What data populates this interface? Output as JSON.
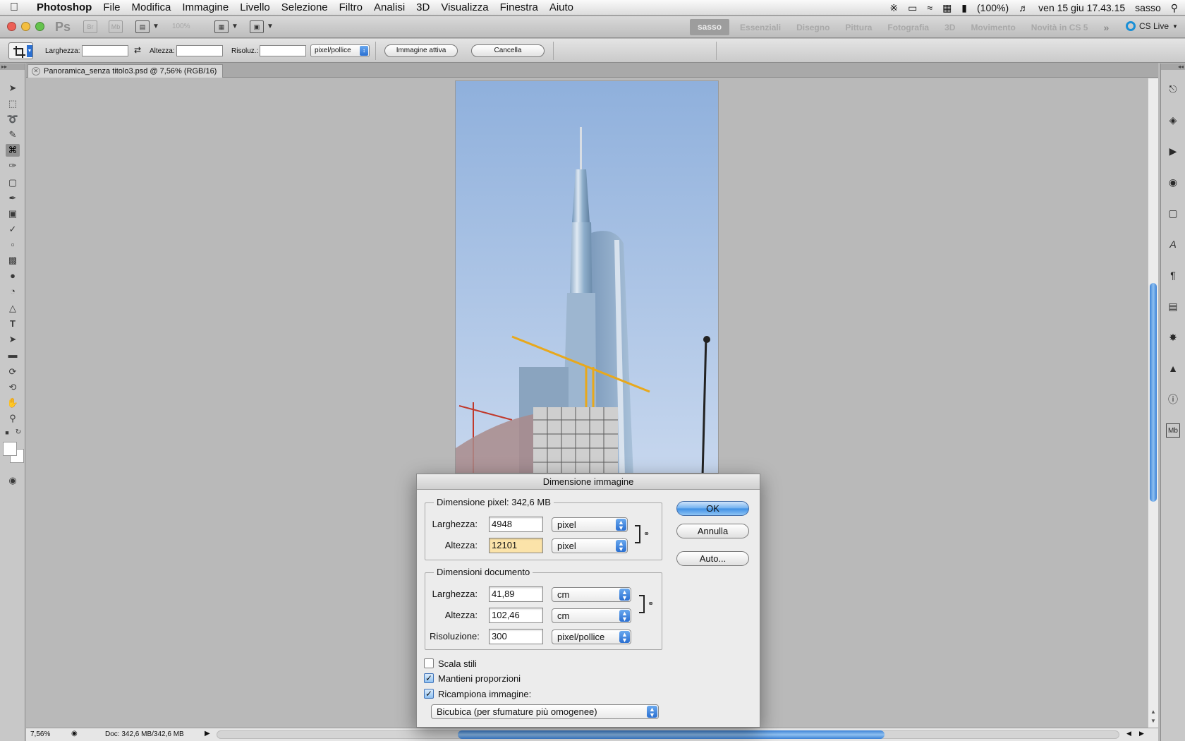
{
  "menubar": {
    "app_name": "Photoshop",
    "items": [
      "File",
      "Modifica",
      "Immagine",
      "Livello",
      "Selezione",
      "Filtro",
      "Analisi",
      "3D",
      "Visualizza",
      "Finestra",
      "Aiuto"
    ],
    "battery": "(100%)",
    "datetime": "ven 15 giu  17.43.15",
    "user": "sasso"
  },
  "appbar": {
    "ps_logo": "Ps",
    "br_label": "Br",
    "mb_label": "Mb",
    "zoom": "100%",
    "workspaces": [
      "sasso",
      "Essenziali",
      "Disegno",
      "Pittura",
      "Fotografia",
      "3D",
      "Movimento",
      "Novità in CS 5"
    ],
    "cs_live": "CS Live"
  },
  "options": {
    "width_label": "Larghezza:",
    "height_label": "Altezza:",
    "res_label": "Risoluz.:",
    "res_unit": "pixel/pollice",
    "front_image_button": "Immagine attiva",
    "clear_button": "Cancella"
  },
  "document": {
    "tab_title": "Panoramica_senza titolo3.psd @ 7,56% (RGB/16)",
    "zoom": "7,56%",
    "doc_info": "Doc: 342,6 MB/342,6 MB"
  },
  "dialog": {
    "title": "Dimensione immagine",
    "pixel_dims_label": "Dimensione pixel:",
    "pixel_dims_size": "342,6 MB",
    "px_width_label": "Larghezza:",
    "px_width_value": "4948",
    "px_width_unit": "pixel",
    "px_height_label": "Altezza:",
    "px_height_value": "12101",
    "px_height_unit": "pixel",
    "doc_dims_label": "Dimensioni documento",
    "doc_width_label": "Larghezza:",
    "doc_width_value": "41,89",
    "doc_width_unit": "cm",
    "doc_height_label": "Altezza:",
    "doc_height_value": "102,46",
    "doc_height_unit": "cm",
    "resolution_label": "Risoluzione:",
    "resolution_value": "300",
    "resolution_unit": "pixel/pollice",
    "scale_styles": "Scala stili",
    "scale_styles_checked": false,
    "constrain": "Mantieni proporzioni",
    "constrain_checked": true,
    "resample": "Ricampiona immagine:",
    "resample_checked": true,
    "resample_method": "Bicubica (per sfumature più omogenee)",
    "ok_button": "OK",
    "cancel_button": "Annulla",
    "auto_button": "Auto..."
  },
  "colors": {
    "accent_blue": "#3d8fe4",
    "sky": "#a9c3e3",
    "crane": "#e8a81c",
    "input_highlight": "#fbe3a9"
  }
}
